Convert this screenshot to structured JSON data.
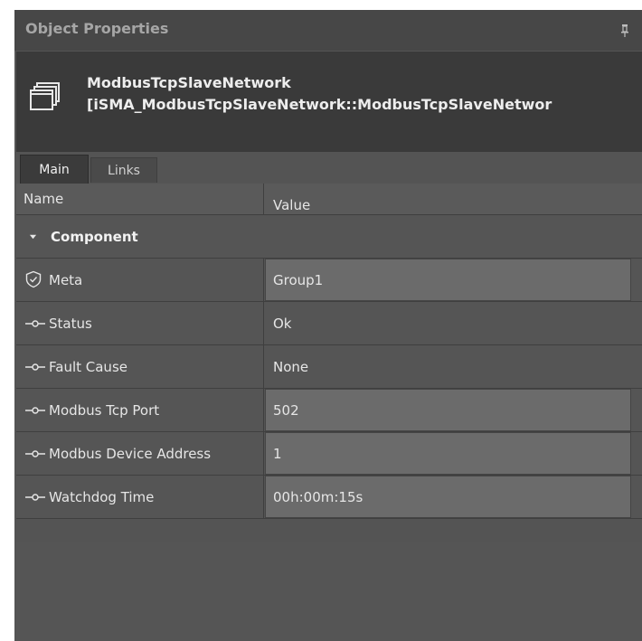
{
  "panel": {
    "title": "Object Properties",
    "pin_icon": "pin-icon"
  },
  "object": {
    "name": "ModbusTcpSlaveNetwork",
    "type": "[iSMA_ModbusTcpSlaveNetwork::ModbusTcpSlaveNetwor",
    "icon": "stacked-windows-icon"
  },
  "tabs": [
    {
      "label": "Main",
      "active": true
    },
    {
      "label": "Links",
      "active": false
    }
  ],
  "grid": {
    "headers": {
      "name": "Name",
      "value": "Value"
    },
    "group": {
      "label": "Component",
      "expanded": true
    },
    "rows": [
      {
        "name": "Meta",
        "value": "Group1",
        "icon": "shield-check-icon",
        "editable": true
      },
      {
        "name": "Status",
        "value": "Ok",
        "icon": "slot-link-icon",
        "editable": false
      },
      {
        "name": "Fault Cause",
        "value": "None",
        "icon": "slot-link-icon",
        "editable": false
      },
      {
        "name": "Modbus Tcp Port",
        "value": "502",
        "icon": "slot-link-icon",
        "editable": true
      },
      {
        "name": "Modbus Device Address",
        "value": "1",
        "icon": "slot-link-icon",
        "editable": true
      },
      {
        "name": "Watchdog Time",
        "value": "00h:00m:15s",
        "icon": "slot-link-icon",
        "editable": true
      }
    ]
  },
  "colors": {
    "panel_bg": "#545454",
    "header_bg": "#3a3a3a",
    "editable_cell": "#6b6b6b"
  }
}
